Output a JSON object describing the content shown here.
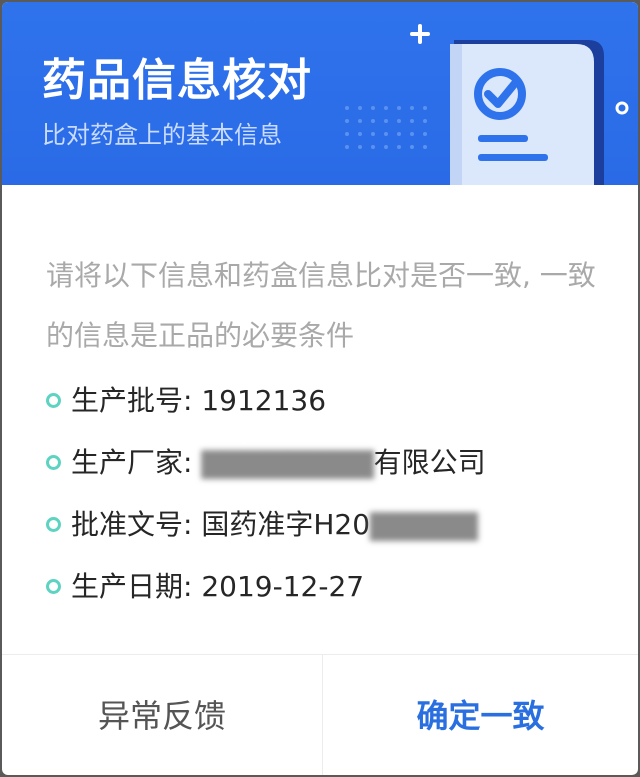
{
  "header": {
    "title": "药品信息核对",
    "subtitle": "比对药盒上的基本信息"
  },
  "intro": {
    "text": "请将以下信息和药盒信息比对是否一致, 一致的信息是正品的必要条件"
  },
  "info_items": [
    {
      "label": "生产批号: ",
      "value": "1912136",
      "obscured": false
    },
    {
      "label": "生产厂家: ",
      "value": "有限公司",
      "obscured_prefix": true
    },
    {
      "label": "批准文号: ",
      "value": "国药准字H20",
      "obscured_suffix": true
    },
    {
      "label": "生产日期: ",
      "value": "2019-12-27",
      "obscured": false
    }
  ],
  "footer": {
    "feedback_label": "异常反馈",
    "confirm_label": "确定一致"
  },
  "colors": {
    "header_blue": "#2f73ec",
    "accent_teal": "#5fd3c1",
    "confirm_blue": "#2a6fe0"
  },
  "icons": {
    "document_check": "document-check-icon",
    "sparkle": "plus-sparkle-icon"
  }
}
